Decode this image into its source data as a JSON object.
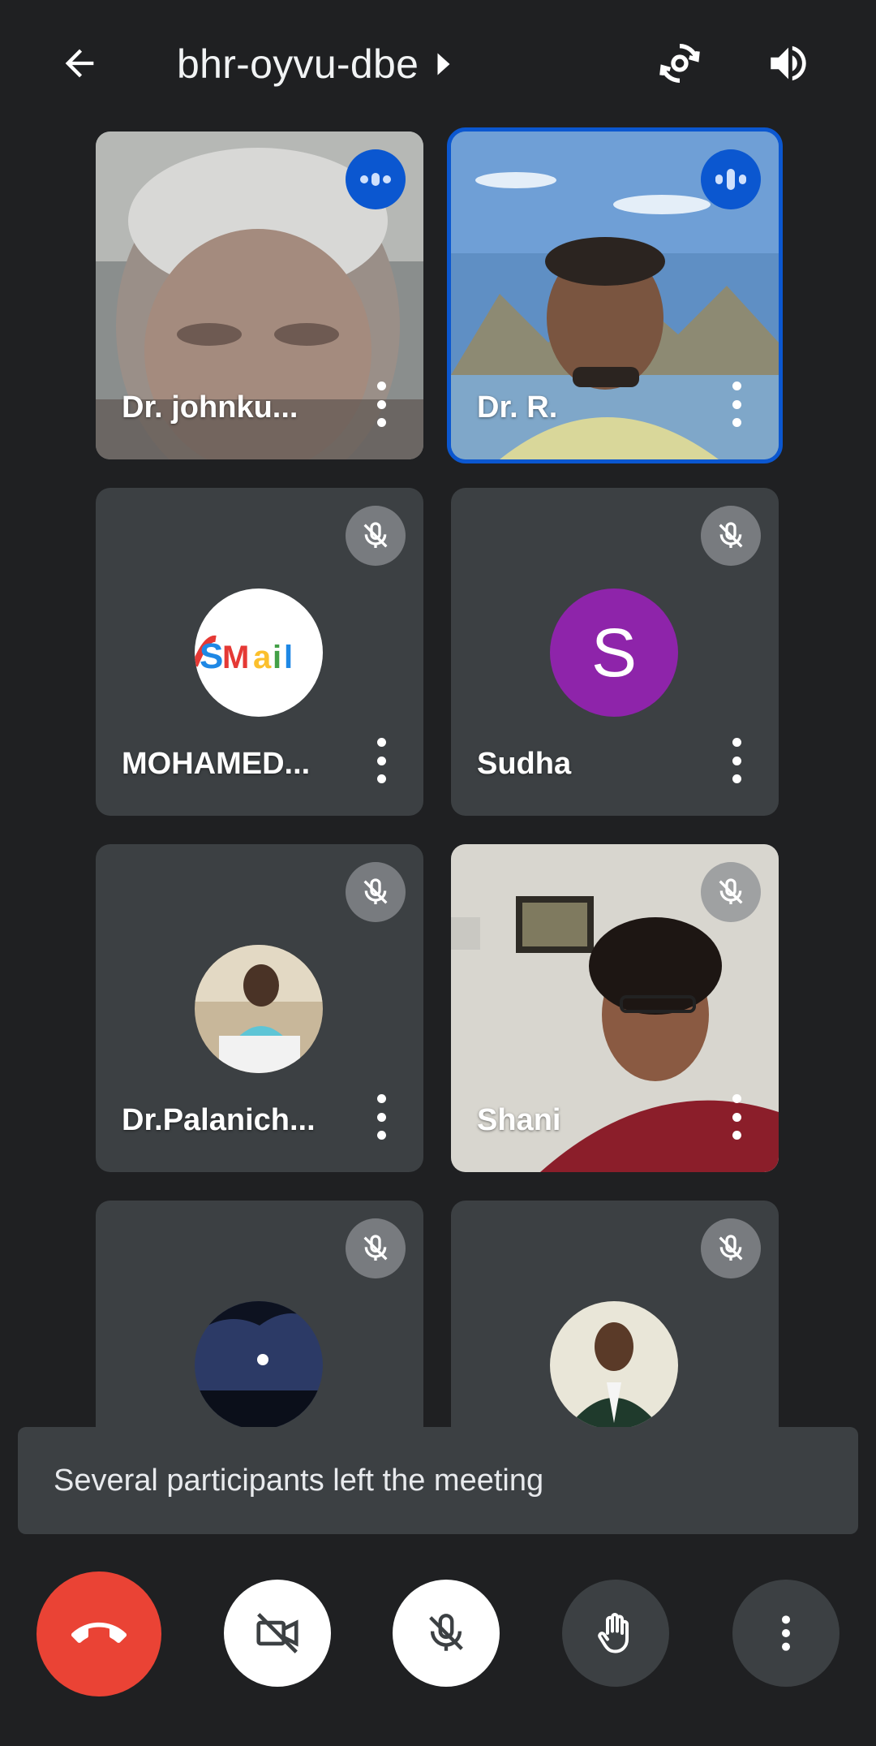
{
  "header": {
    "meeting_code": "bhr-oyvu-dbe",
    "back_icon": "arrow-back-icon",
    "switch_camera_icon": "switch-camera-icon",
    "audio_icon": "speaker-icon"
  },
  "participants": [
    {
      "name": "Dr. johnku...",
      "state": "speaking",
      "tile": "video"
    },
    {
      "name": "Dr. R.",
      "state": "speaking",
      "tile": "video",
      "active_speaker": true
    },
    {
      "name": "MOHAMED...",
      "state": "muted",
      "tile": "avatar",
      "avatar_text": "SMail"
    },
    {
      "name": "Sudha",
      "state": "muted",
      "tile": "letter-avatar",
      "avatar_letter": "S"
    },
    {
      "name": "Dr.Palanich...",
      "state": "muted",
      "tile": "avatar"
    },
    {
      "name": "Shani",
      "state": "muted",
      "tile": "video"
    },
    {
      "name": "",
      "state": "muted",
      "tile": "avatar"
    },
    {
      "name": "",
      "state": "muted",
      "tile": "avatar"
    }
  ],
  "toast": {
    "message": "Several participants left the meeting"
  },
  "controls": {
    "end_call_icon": "end-call-icon",
    "camera_icon": "camera-off-icon",
    "mic_icon": "mic-off-icon",
    "hand_icon": "raise-hand-icon",
    "more_icon": "more-vert-icon"
  },
  "colors": {
    "background": "#1f2022",
    "tile": "#3c4043",
    "active_outline": "#0b57d0",
    "end_call": "#ea4335",
    "letter_avatar": "#8e24aa"
  }
}
